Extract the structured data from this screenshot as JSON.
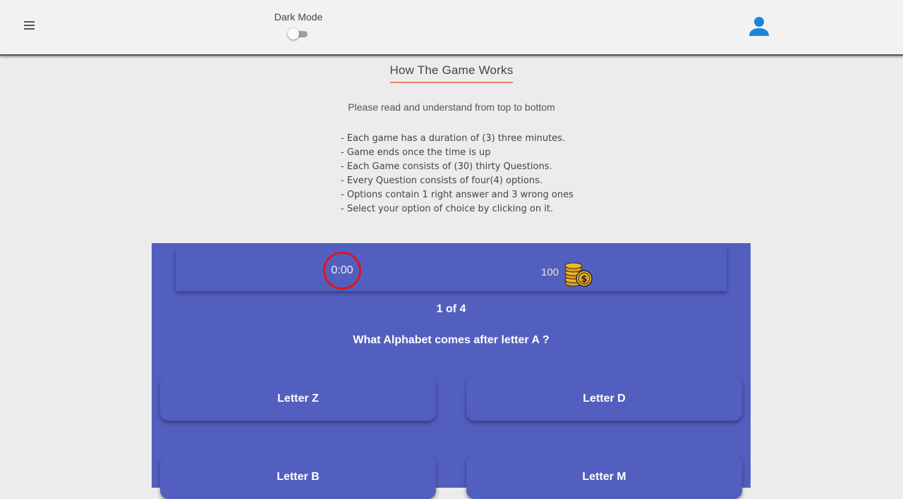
{
  "header": {
    "dark_mode_label": "Dark Mode",
    "dark_mode_on": false
  },
  "instructions": {
    "title": "How The Game Works",
    "subtitle": "Please read and understand from top to bottom",
    "rules": [
      "- Each game has a duration of (3) three minutes.",
      "- Game ends once the time is up",
      "- Each Game consists of (30) thirty Questions.",
      "- Every Question consists of four(4) options.",
      "- Options contain 1 right answer and 3 wrong ones",
      "- Select your option of choice by clicking on it."
    ]
  },
  "game": {
    "timer": "0:00",
    "coins": "100",
    "counter": "1 of 4",
    "question": "What Alphabet comes after letter A ?",
    "options": [
      "Letter Z",
      "Letter D",
      "Letter B",
      "Letter M"
    ]
  },
  "icons": {
    "menu": "menu-icon",
    "account": "account-icon",
    "coins": "coins-icon"
  },
  "colors": {
    "panel": "#535fbf",
    "accent_underline": "#f07a6a",
    "timer_ring": "#e0141c",
    "account_icon": "#1a86d6"
  }
}
